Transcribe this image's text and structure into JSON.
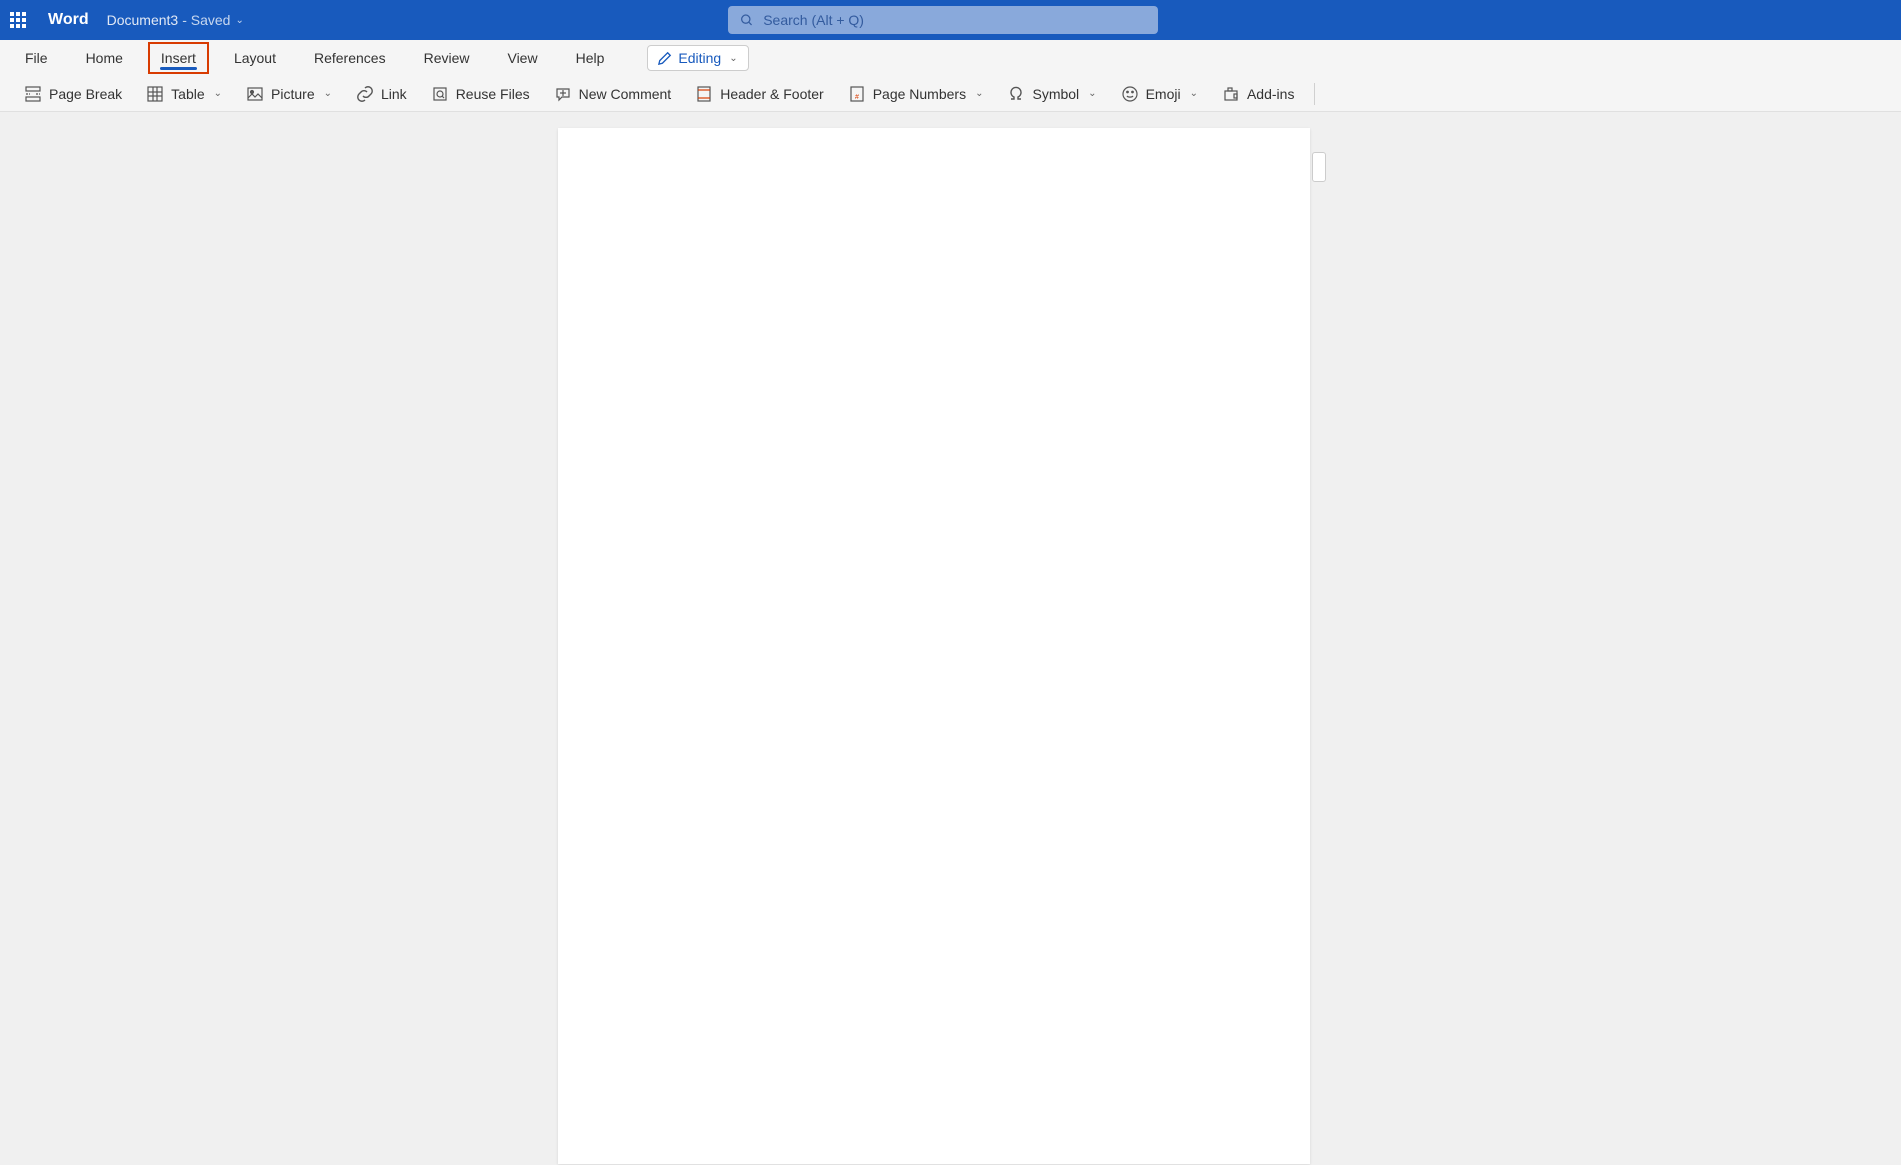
{
  "titlebar": {
    "app_name": "Word",
    "doc_name": "Document3",
    "saved_status": "- Saved"
  },
  "search": {
    "placeholder": "Search (Alt + Q)"
  },
  "tabs": [
    {
      "label": "File"
    },
    {
      "label": "Home"
    },
    {
      "label": "Insert"
    },
    {
      "label": "Layout"
    },
    {
      "label": "References"
    },
    {
      "label": "Review"
    },
    {
      "label": "View"
    },
    {
      "label": "Help"
    }
  ],
  "editing_button": {
    "label": "Editing"
  },
  "toolbar": {
    "page_break": "Page Break",
    "table": "Table",
    "picture": "Picture",
    "link": "Link",
    "reuse_files": "Reuse Files",
    "new_comment": "New Comment",
    "header_footer": "Header & Footer",
    "page_numbers": "Page Numbers",
    "symbol": "Symbol",
    "emoji": "Emoji",
    "addins": "Add-ins"
  }
}
